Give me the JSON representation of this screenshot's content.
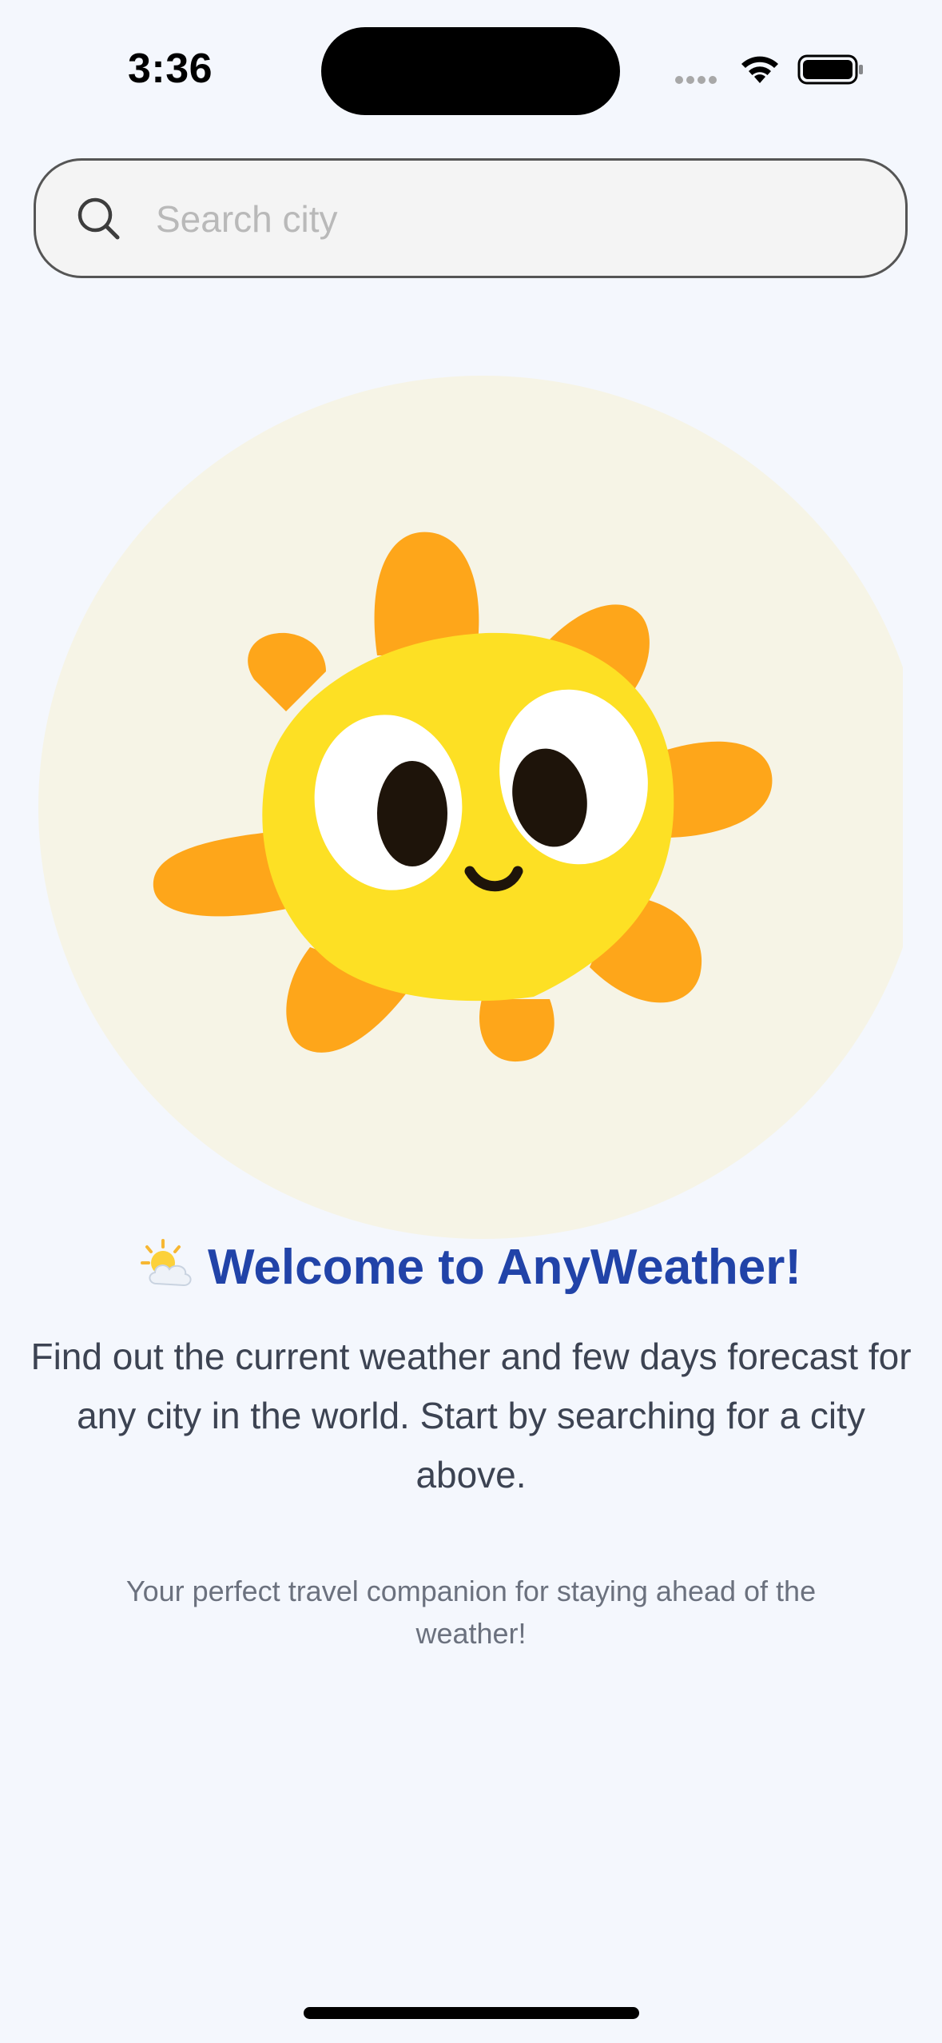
{
  "status_bar": {
    "time": "3:36"
  },
  "search": {
    "placeholder": "Search city",
    "value": ""
  },
  "welcome": {
    "emoji": "⛅",
    "title": "Welcome to AnyWeather!",
    "description": "Find out the current weather and few days forecast for any city in the world. Start by searching for a city above.",
    "tagline": "Your perfect travel companion for staying ahead of the weather!"
  },
  "colors": {
    "background": "#f4f7fd",
    "title": "#2143a8",
    "sun_body": "#fde024",
    "sun_rays": "#fea61a",
    "illustration_bg": "#f6f4e6"
  },
  "icons": {
    "search": "search-icon",
    "illustration": "sun-character-illustration"
  }
}
